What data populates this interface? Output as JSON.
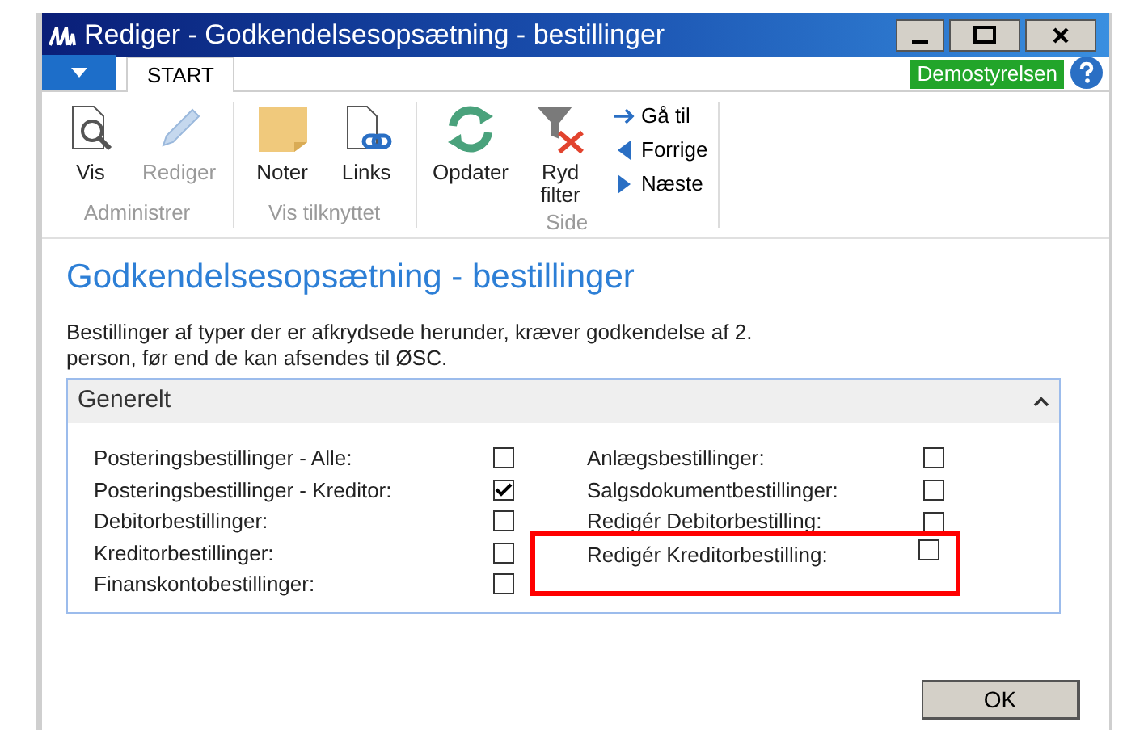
{
  "window": {
    "title": "Rediger - Godkendelsesopsætning - bestillinger"
  },
  "tabs": [
    {
      "label": "START",
      "selected": true
    }
  ],
  "company": "Demostyrelsen",
  "ribbon": [
    {
      "label": "Administrer",
      "buttons": [
        {
          "kind": "view",
          "label": "Vis",
          "disabled": false
        },
        {
          "kind": "edit",
          "label": "Rediger",
          "disabled": true
        }
      ]
    },
    {
      "label": "Vis tilknyttet",
      "buttons": [
        {
          "kind": "notes",
          "label": "Noter",
          "disabled": false
        },
        {
          "kind": "links",
          "label": "Links",
          "disabled": false
        }
      ]
    },
    {
      "label": "Side",
      "buttons": [
        {
          "kind": "refresh",
          "label": "Opdater",
          "disabled": false
        },
        {
          "kind": "clearfilter",
          "label": "Ryd filter",
          "disabled": false
        }
      ],
      "small": [
        {
          "kind": "goto",
          "label": "Gå til"
        },
        {
          "kind": "prev",
          "label": "Forrige"
        },
        {
          "kind": "next",
          "label": "Næste"
        }
      ]
    }
  ],
  "page_title": "Godkendelsesopsætning - bestillinger",
  "description": "Bestillinger af typer der er afkrydsede herunder, kræver godkendelse af 2. person, før end de kan afsendes til ØSC.",
  "section": {
    "title": "Generelt",
    "expanded": true,
    "columns": [
      [
        {
          "label": "Posteringsbestillinger - Alle:",
          "checked": false,
          "highlighted": false
        },
        {
          "label": "Posteringsbestillinger - Kreditor:",
          "checked": true,
          "highlighted": false
        },
        {
          "label": "Debitorbestillinger:",
          "checked": false,
          "highlighted": false
        },
        {
          "label": "Kreditorbestillinger:",
          "checked": false,
          "highlighted": false
        },
        {
          "label": "Finanskontobestillinger:",
          "checked": false,
          "highlighted": false
        }
      ],
      [
        {
          "label": "Anlægsbestillinger:",
          "checked": false,
          "highlighted": false
        },
        {
          "label": "Salgsdokumentbestillinger:",
          "checked": false,
          "highlighted": false
        },
        {
          "label": "Redigér Debitorbestilling:",
          "checked": false,
          "highlighted": false
        },
        {
          "label": "Redigér Kreditorbestilling:",
          "checked": false,
          "highlighted": true
        }
      ]
    ]
  },
  "buttons": [
    "OK"
  ]
}
